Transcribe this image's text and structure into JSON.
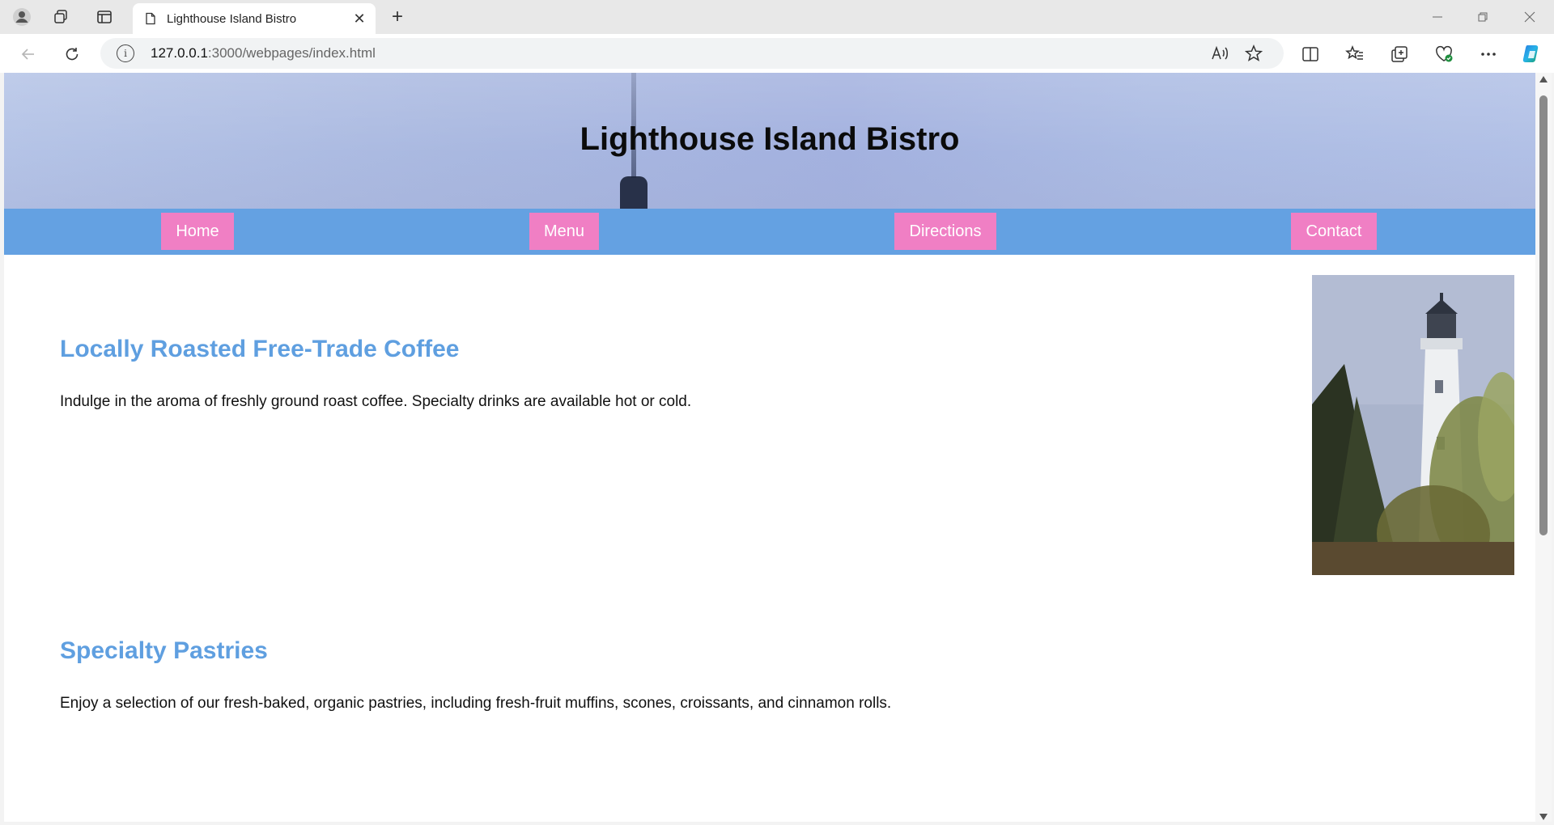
{
  "browser": {
    "tab_title": "Lighthouse Island Bistro",
    "url_host": "127.0.0.1",
    "url_path": ":3000/webpages/index.html"
  },
  "page": {
    "site_title": "Lighthouse Island Bistro",
    "nav": [
      {
        "label": "Home"
      },
      {
        "label": "Menu"
      },
      {
        "label": "Directions"
      },
      {
        "label": "Contact"
      }
    ],
    "sections": [
      {
        "heading": "Locally Roasted Free-Trade Coffee",
        "text": "Indulge in the aroma of freshly ground roast coffee. Specialty drinks are available hot or cold."
      },
      {
        "heading": "Specialty Pastries",
        "text": "Enjoy a selection of our fresh-baked, organic pastries, including fresh-fruit muffins, scones, croissants, and cinnamon rolls."
      }
    ]
  },
  "colors": {
    "nav_bar": "#64a1e2",
    "nav_button": "#f07fc4",
    "heading": "#5f9fe0"
  }
}
